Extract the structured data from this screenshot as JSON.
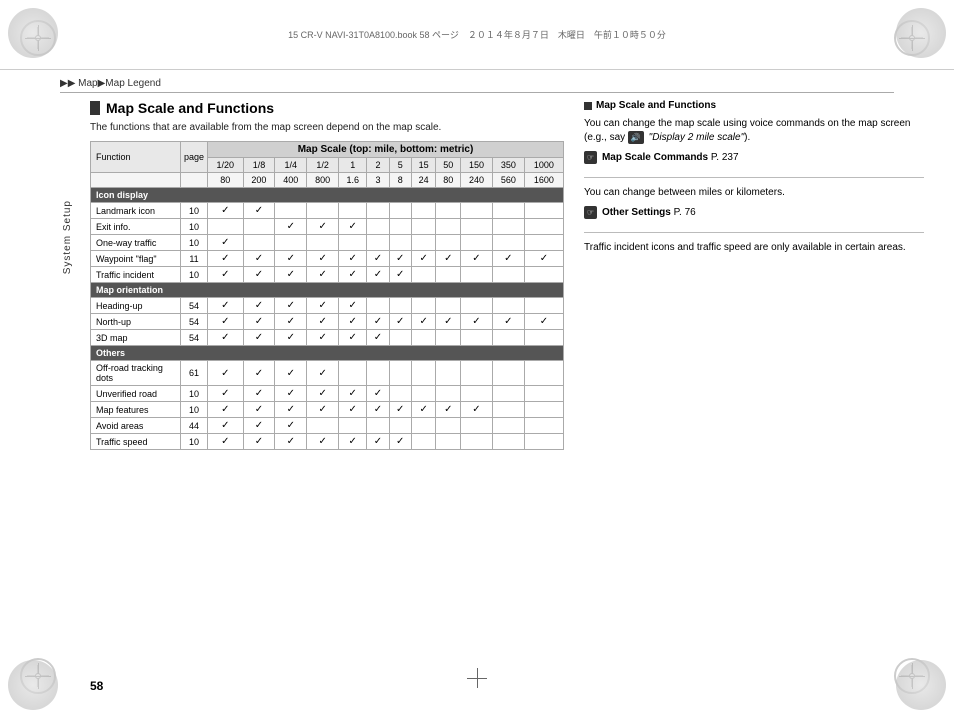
{
  "page": {
    "number": "58",
    "header_text": "15 CR-V NAVI-31T0A8100.book  58 ページ　２０１４年８月７日　木曜日　午前１０時５０分"
  },
  "breadcrumb": {
    "parts": [
      "▶▶ Map",
      "Map Legend"
    ],
    "separator": "▶"
  },
  "system_setup_label": "System Setup",
  "section": {
    "title": "Map Scale and Functions",
    "intro": "The functions that are available from the map screen depend on the map scale.",
    "table": {
      "header_row1": "Map Scale (top: mile, bottom: metric)",
      "col_headers": [
        "Function",
        "page",
        "1/20",
        "1/8",
        "1/4",
        "1/2",
        "1",
        "2",
        "5",
        "15",
        "50",
        "150",
        "350",
        "1000"
      ],
      "col_headers2": [
        "",
        "",
        "80",
        "200",
        "400",
        "800",
        "1.6",
        "3",
        "8",
        "24",
        "80",
        "240",
        "560",
        "1600"
      ],
      "sections": [
        {
          "section_name": "Icon display",
          "rows": [
            {
              "name": "Landmark icon",
              "page": "10",
              "checks": [
                1,
                1,
                0,
                0,
                0,
                0,
                0,
                0,
                0,
                0,
                0,
                0
              ]
            },
            {
              "name": "Exit info.",
              "page": "10",
              "checks": [
                0,
                0,
                1,
                1,
                1,
                0,
                0,
                0,
                0,
                0,
                0,
                0
              ]
            },
            {
              "name": "One-way traffic",
              "page": "10",
              "checks": [
                1,
                0,
                0,
                0,
                0,
                0,
                0,
                0,
                0,
                0,
                0,
                0
              ]
            },
            {
              "name": "Waypoint \"flag\"",
              "page": "11",
              "checks": [
                1,
                1,
                1,
                1,
                1,
                1,
                1,
                1,
                1,
                1,
                1,
                1
              ]
            },
            {
              "name": "Traffic incident",
              "page": "10",
              "checks": [
                1,
                1,
                1,
                1,
                1,
                1,
                1,
                0,
                0,
                0,
                0,
                0
              ]
            }
          ]
        },
        {
          "section_name": "Map orientation",
          "rows": [
            {
              "name": "Heading-up",
              "page": "54",
              "checks": [
                1,
                1,
                1,
                1,
                1,
                0,
                0,
                0,
                0,
                0,
                0,
                0
              ]
            },
            {
              "name": "North-up",
              "page": "54",
              "checks": [
                1,
                1,
                1,
                1,
                1,
                1,
                1,
                1,
                1,
                1,
                1,
                1
              ]
            },
            {
              "name": "3D map",
              "page": "54",
              "checks": [
                1,
                1,
                1,
                1,
                1,
                1,
                0,
                0,
                0,
                0,
                0,
                0
              ]
            }
          ]
        },
        {
          "section_name": "Others",
          "rows": [
            {
              "name": "Off-road tracking dots",
              "page": "61",
              "checks": [
                1,
                1,
                1,
                1,
                0,
                0,
                0,
                0,
                0,
                0,
                0,
                0
              ]
            },
            {
              "name": "Unverified road",
              "page": "10",
              "checks": [
                1,
                1,
                1,
                1,
                1,
                1,
                0,
                0,
                0,
                0,
                0,
                0
              ]
            },
            {
              "name": "Map features",
              "page": "10",
              "checks": [
                1,
                1,
                1,
                1,
                1,
                1,
                1,
                1,
                1,
                1,
                0,
                0
              ]
            },
            {
              "name": "Avoid areas",
              "page": "44",
              "checks": [
                1,
                1,
                1,
                0,
                0,
                0,
                0,
                0,
                0,
                0,
                0,
                0
              ]
            },
            {
              "name": "Traffic speed",
              "page": "10",
              "checks": [
                1,
                1,
                1,
                1,
                1,
                1,
                1,
                0,
                0,
                0,
                0,
                0
              ]
            }
          ]
        }
      ]
    }
  },
  "right_panel": {
    "title": "Map Scale and Functions",
    "paragraphs": [
      "You can change the map scale using voice commands on the map screen (e.g., say",
      "\"Display 2 mile scale\").",
      "Map Scale Commands P. 237",
      "",
      "You can change between miles or kilometers.",
      "Other Settings P. 76",
      "",
      "Traffic incident icons and traffic speed are only available in certain areas."
    ],
    "map_commands_label": "Map Scale Commands",
    "map_commands_page": "P. 237",
    "other_settings_label": "Other Settings",
    "other_settings_page": "P. 76",
    "traffic_note": "Traffic incident icons and traffic speed are only available in certain areas."
  }
}
